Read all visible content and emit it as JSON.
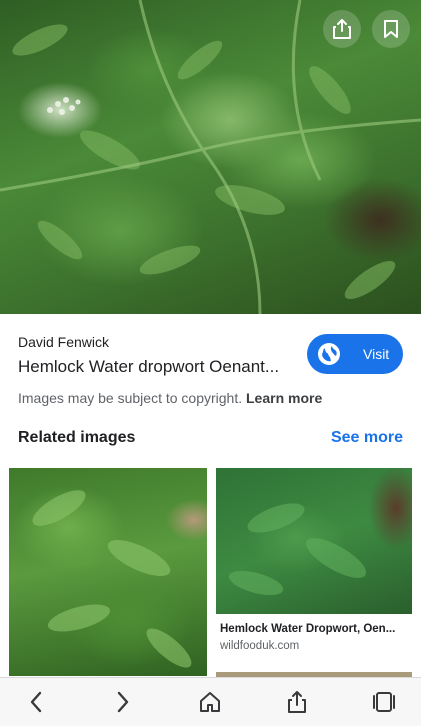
{
  "hero": {
    "icons": {
      "share": "share-icon",
      "bookmark": "bookmark-icon"
    }
  },
  "result": {
    "source": "David Fenwick",
    "title": "Hemlock Water dropwort Oenant...",
    "visit_label": "Visit",
    "copyright_text": "Images may be subject to copyright.",
    "learn_more": "Learn more"
  },
  "related": {
    "heading": "Related images",
    "see_more": "See more",
    "items": [
      {
        "caption": "",
        "domain": ""
      },
      {
        "caption": "Hemlock Water Dropwort, Oen...",
        "domain": "wildfooduk.com"
      }
    ]
  },
  "toolbar": {
    "icons": [
      "back-icon",
      "forward-icon",
      "home-icon",
      "share-icon",
      "tabs-icon"
    ]
  },
  "colors": {
    "accent": "#1a73e8",
    "text": "#202124",
    "secondary": "#5f6368"
  }
}
